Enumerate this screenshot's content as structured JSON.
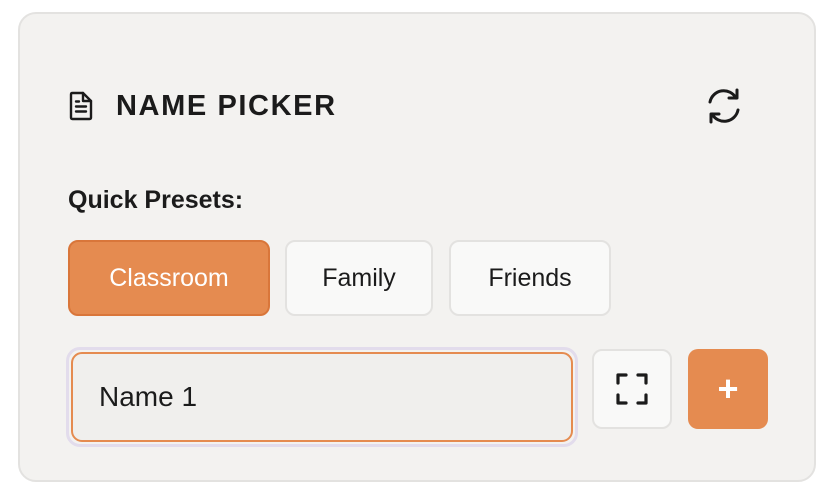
{
  "header": {
    "title": "NAME PICKER",
    "title_icon": "document-icon",
    "refresh_icon": "refresh-icon"
  },
  "presets": {
    "label": "Quick Presets:",
    "items": [
      {
        "label": "Classroom",
        "active": true
      },
      {
        "label": "Family",
        "active": false
      },
      {
        "label": "Friends",
        "active": false
      }
    ]
  },
  "entry": {
    "value": "Name 1",
    "expand_icon": "fullscreen-icon",
    "add_label": "+"
  },
  "colors": {
    "accent": "#e58b50",
    "background": "#f3f2f0",
    "text": "#1b1b1b"
  }
}
